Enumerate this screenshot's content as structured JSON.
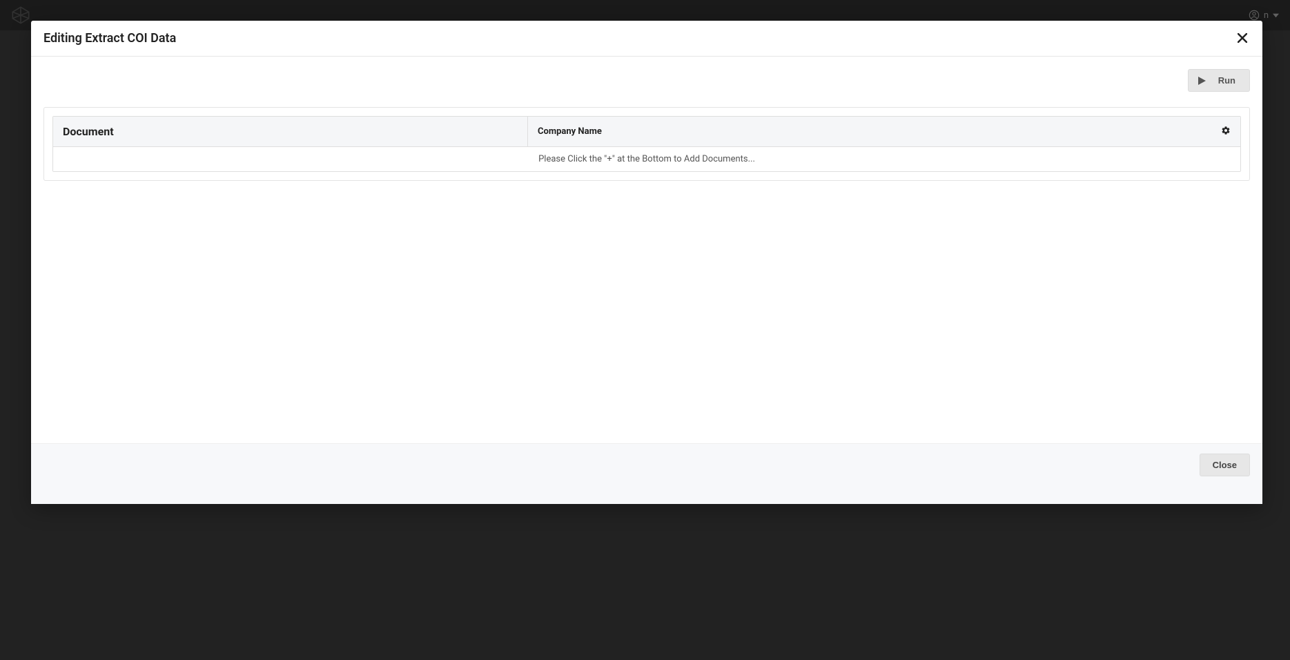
{
  "modal": {
    "title": "Editing Extract COI Data",
    "run_label": "Run",
    "close_label": "Close"
  },
  "table": {
    "columns": {
      "document": "Document",
      "company_name": "Company Name"
    },
    "empty_message": "Please Click the \"+\" at the Bottom to Add Documents..."
  },
  "backdrop": {
    "user_suffix": "n"
  }
}
